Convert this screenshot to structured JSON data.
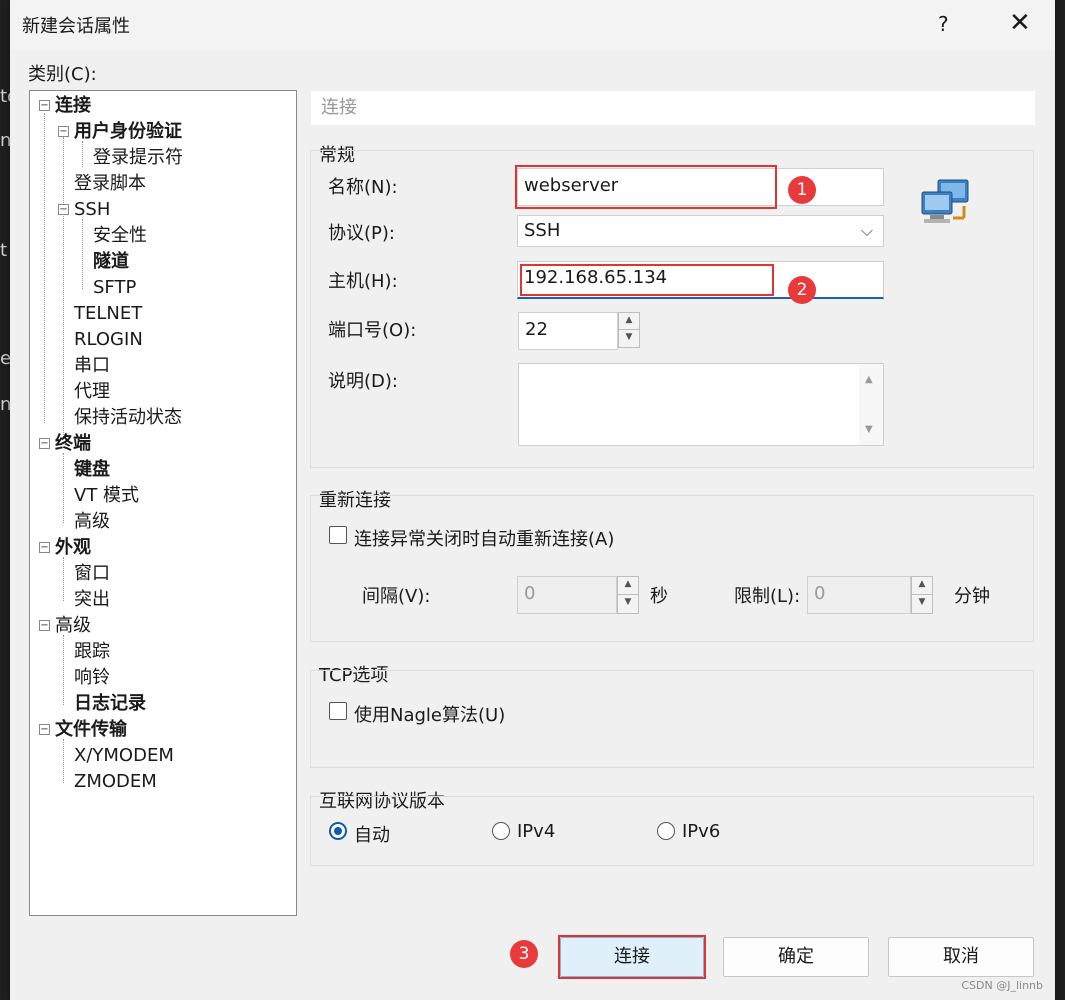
{
  "window": {
    "title": "新建会话属性",
    "help": "?",
    "close": "✕"
  },
  "category_label": "类别(C):",
  "tree": [
    {
      "label": "连接",
      "bold": true
    },
    {
      "label": "用户身份验证",
      "bold": true
    },
    {
      "label": "登录提示符",
      "bold": false
    },
    {
      "label": "登录脚本",
      "bold": false
    },
    {
      "label": "SSH",
      "bold": false
    },
    {
      "label": "安全性",
      "bold": false
    },
    {
      "label": "隧道",
      "bold": true
    },
    {
      "label": "SFTP",
      "bold": false
    },
    {
      "label": "TELNET",
      "bold": false
    },
    {
      "label": "RLOGIN",
      "bold": false
    },
    {
      "label": "串口",
      "bold": false
    },
    {
      "label": "代理",
      "bold": false
    },
    {
      "label": "保持活动状态",
      "bold": false
    },
    {
      "label": "终端",
      "bold": true
    },
    {
      "label": "键盘",
      "bold": true
    },
    {
      "label": "VT 模式",
      "bold": false
    },
    {
      "label": "高级",
      "bold": false
    },
    {
      "label": "外观",
      "bold": true
    },
    {
      "label": "窗口",
      "bold": false
    },
    {
      "label": "突出",
      "bold": false
    },
    {
      "label": "高级",
      "bold": false
    },
    {
      "label": "跟踪",
      "bold": false
    },
    {
      "label": "响铃",
      "bold": false
    },
    {
      "label": "日志记录",
      "bold": true
    },
    {
      "label": "文件传输",
      "bold": true
    },
    {
      "label": "X/YMODEM",
      "bold": false
    },
    {
      "label": "ZMODEM",
      "bold": false
    }
  ],
  "panel_title": "连接",
  "general": {
    "group_label": "常规",
    "name_label": "名称(N):",
    "name_value": "webserver",
    "protocol_label": "协议(P):",
    "protocol_value": "SSH",
    "host_label": "主机(H):",
    "host_value": "192.168.65.134",
    "port_label": "端口号(O):",
    "port_value": "22",
    "desc_label": "说明(D):",
    "desc_value": ""
  },
  "reconnect": {
    "group_label": "重新连接",
    "checkbox_label": "连接异常关闭时自动重新连接(A)",
    "interval_label": "间隔(V):",
    "interval_value": "0",
    "interval_unit": "秒",
    "limit_label": "限制(L):",
    "limit_value": "0",
    "limit_unit": "分钟"
  },
  "tcp": {
    "group_label": "TCP选项",
    "nagle_label": "使用Nagle算法(U)"
  },
  "ip_version": {
    "group_label": "互联网协议版本",
    "options": [
      "自动",
      "IPv4",
      "IPv6"
    ],
    "selected": "自动"
  },
  "buttons": {
    "connect": "连接",
    "ok": "确定",
    "cancel": "取消"
  },
  "annotations": {
    "badge1": "1",
    "badge2": "2",
    "badge3": "3"
  },
  "background_letters": [
    "to",
    "ne",
    "t",
    "e",
    "ne"
  ],
  "watermark": "CSDN @J_linnb"
}
